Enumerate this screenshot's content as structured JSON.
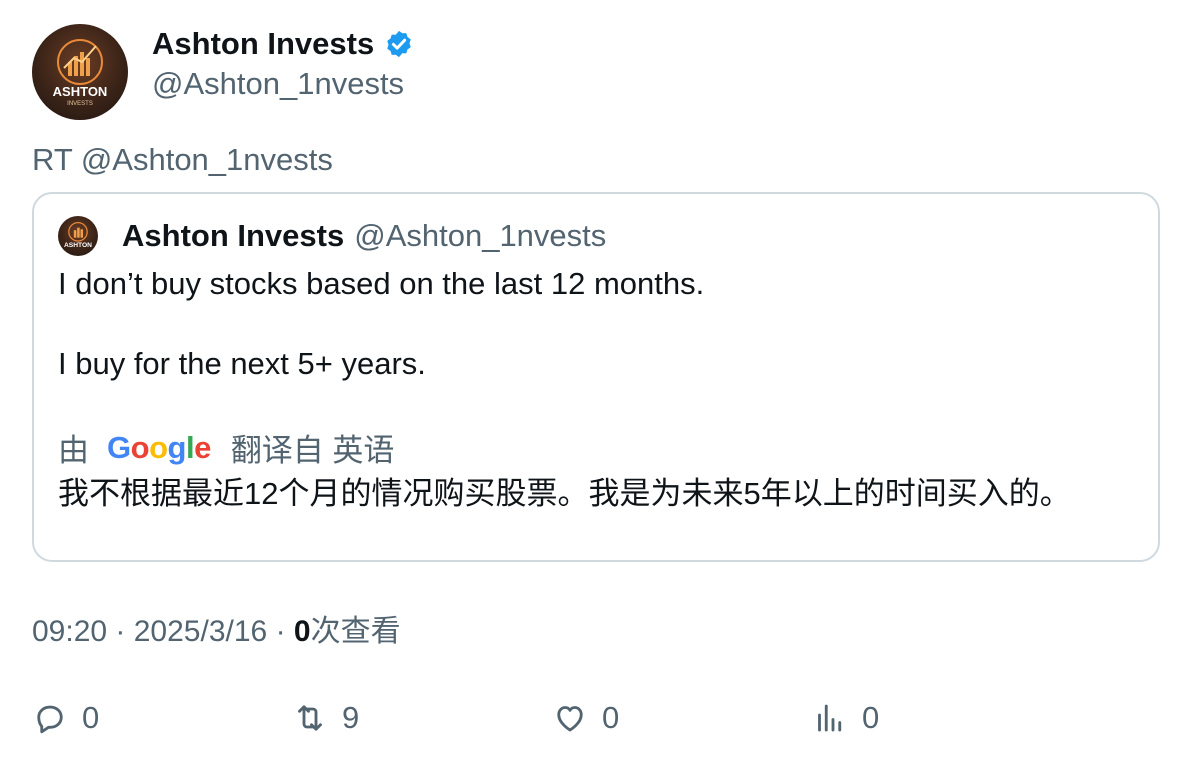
{
  "author": {
    "display_name": "Ashton Invests",
    "handle": "@Ashton_1nvests",
    "avatar_text": "ASHTON",
    "avatar_subtext": "INVESTS"
  },
  "retweet_line": "RT @Ashton_1nvests",
  "quoted": {
    "display_name": "Ashton Invests",
    "handle": "@Ashton_1nvests",
    "line1": "I don’t buy stocks based on the last 12 months.",
    "line2": "I buy for the next 5+ years.",
    "translate_prefix": "由",
    "translate_suffix": "翻译自 英语",
    "translated_text": "我不根据最近12个月的情况购买股票。我是为未来5年以上的时间买入的。"
  },
  "meta": {
    "time": "09:20",
    "date": "2025/3/16",
    "views_count": "0",
    "views_label": "次查看"
  },
  "actions": {
    "replies": "0",
    "retweets": "9",
    "likes": "0",
    "views": "0"
  },
  "colors": {
    "secondary_text": "#536471",
    "verified_blue": "#1d9bf0",
    "border": "#cfd9de"
  }
}
